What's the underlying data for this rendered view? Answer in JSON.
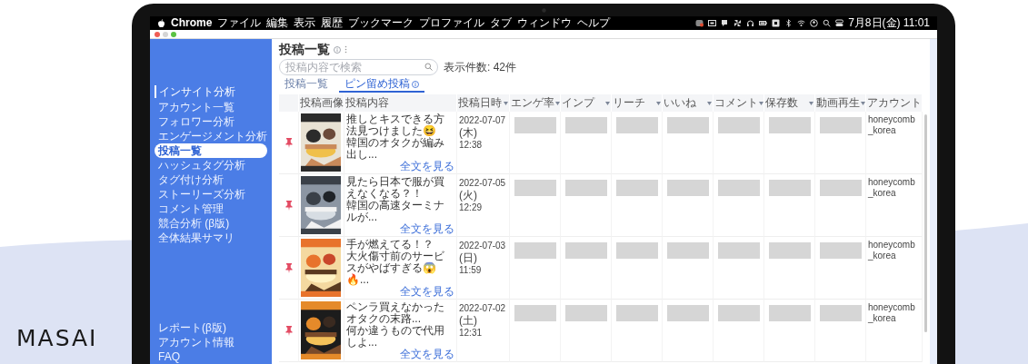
{
  "brand": "MASAI",
  "menu_bar": {
    "app": "Chrome",
    "menus": [
      "ファイル",
      "編集",
      "表示",
      "履歴",
      "ブックマーク",
      "プロファイル",
      "タブ",
      "ウィンドウ",
      "ヘルプ"
    ],
    "clock": "7月8日(金) 11:01"
  },
  "sidebar": {
    "section": "インサイト分析",
    "items": [
      {
        "label": "アカウント一覧",
        "selected": false
      },
      {
        "label": "フォロワー分析",
        "selected": false
      },
      {
        "label": "エンゲージメント分析",
        "selected": false
      },
      {
        "label": "投稿一覧",
        "selected": true
      },
      {
        "label": "ハッシュタグ分析",
        "selected": false
      },
      {
        "label": "タグ付け分析",
        "selected": false
      },
      {
        "label": "ストーリーズ分析",
        "selected": false
      },
      {
        "label": "コメント管理",
        "selected": false
      },
      {
        "label": "競合分析 (β版)",
        "selected": false
      },
      {
        "label": "全体結果サマリ",
        "selected": false
      }
    ],
    "footer_items": [
      {
        "label": "レポート(β版)",
        "selected": false
      },
      {
        "label": "アカウント情報",
        "selected": false
      },
      {
        "label": "FAQ",
        "selected": false
      }
    ]
  },
  "page": {
    "title": "投稿一覧",
    "search": {
      "placeholder": "投稿内容で検索"
    },
    "result_count": "表示件数: 42件",
    "tabs": [
      {
        "label": "投稿一覧",
        "selected": false,
        "info": false
      },
      {
        "label": "ピン留め投稿",
        "selected": true,
        "info": true
      }
    ]
  },
  "table": {
    "columns": [
      {
        "kind": "pin"
      },
      {
        "label": "投稿画像",
        "sortable": false
      },
      {
        "label": "投稿内容",
        "kind": "content",
        "sortable": false
      },
      {
        "label": "投稿日時",
        "kind": "date",
        "sortable": true
      },
      {
        "label": "エンゲ率",
        "kind": "metric",
        "sortable": true
      },
      {
        "label": "インプ",
        "kind": "metric",
        "sortable": true
      },
      {
        "label": "リーチ",
        "kind": "metric",
        "sortable": true
      },
      {
        "label": "いいね",
        "kind": "metric",
        "sortable": true
      },
      {
        "label": "コメント",
        "kind": "metric",
        "sortable": true
      },
      {
        "label": "保存数",
        "kind": "metric",
        "sortable": true
      },
      {
        "label": "動画再生",
        "kind": "metric",
        "sortable": true
      },
      {
        "label": "アカウント",
        "kind": "account",
        "sortable": false
      }
    ],
    "rows": [
      {
        "pinned": true,
        "title": "推しとキスできる方法見つけました😆",
        "excerpt": "韓国のオタクが編み出し...",
        "more_link": "全文を見る",
        "date": "2022-07-07",
        "weekday": "(木)",
        "time": "12:38",
        "values_hidden": true,
        "account": "honeycomb_korea"
      },
      {
        "pinned": true,
        "title": "見たら日本で服が買えなくなる？！",
        "excerpt": "韓国の高速ターミナルが...",
        "more_link": "全文を見る",
        "date": "2022-07-05",
        "weekday": "(火)",
        "time": "12:29",
        "values_hidden": true,
        "account": "honeycomb_korea"
      },
      {
        "pinned": true,
        "title": "手が燃えてる！？",
        "excerpt": "大火傷寸前のサービスがやばすぎる😱🔥...",
        "more_link": "全文を見る",
        "date": "2022-07-03",
        "weekday": "(日)",
        "time": "11:59",
        "values_hidden": true,
        "account": "honeycomb_korea"
      },
      {
        "pinned": true,
        "title": "ペンラ買えなかったオタクの末路...",
        "excerpt": "何か違うもので代用しよ...",
        "more_link": "全文を見る",
        "date": "2022-07-02",
        "weekday": "(土)",
        "time": "12:31",
        "values_hidden": true,
        "account": "honeycomb_korea"
      }
    ]
  }
}
